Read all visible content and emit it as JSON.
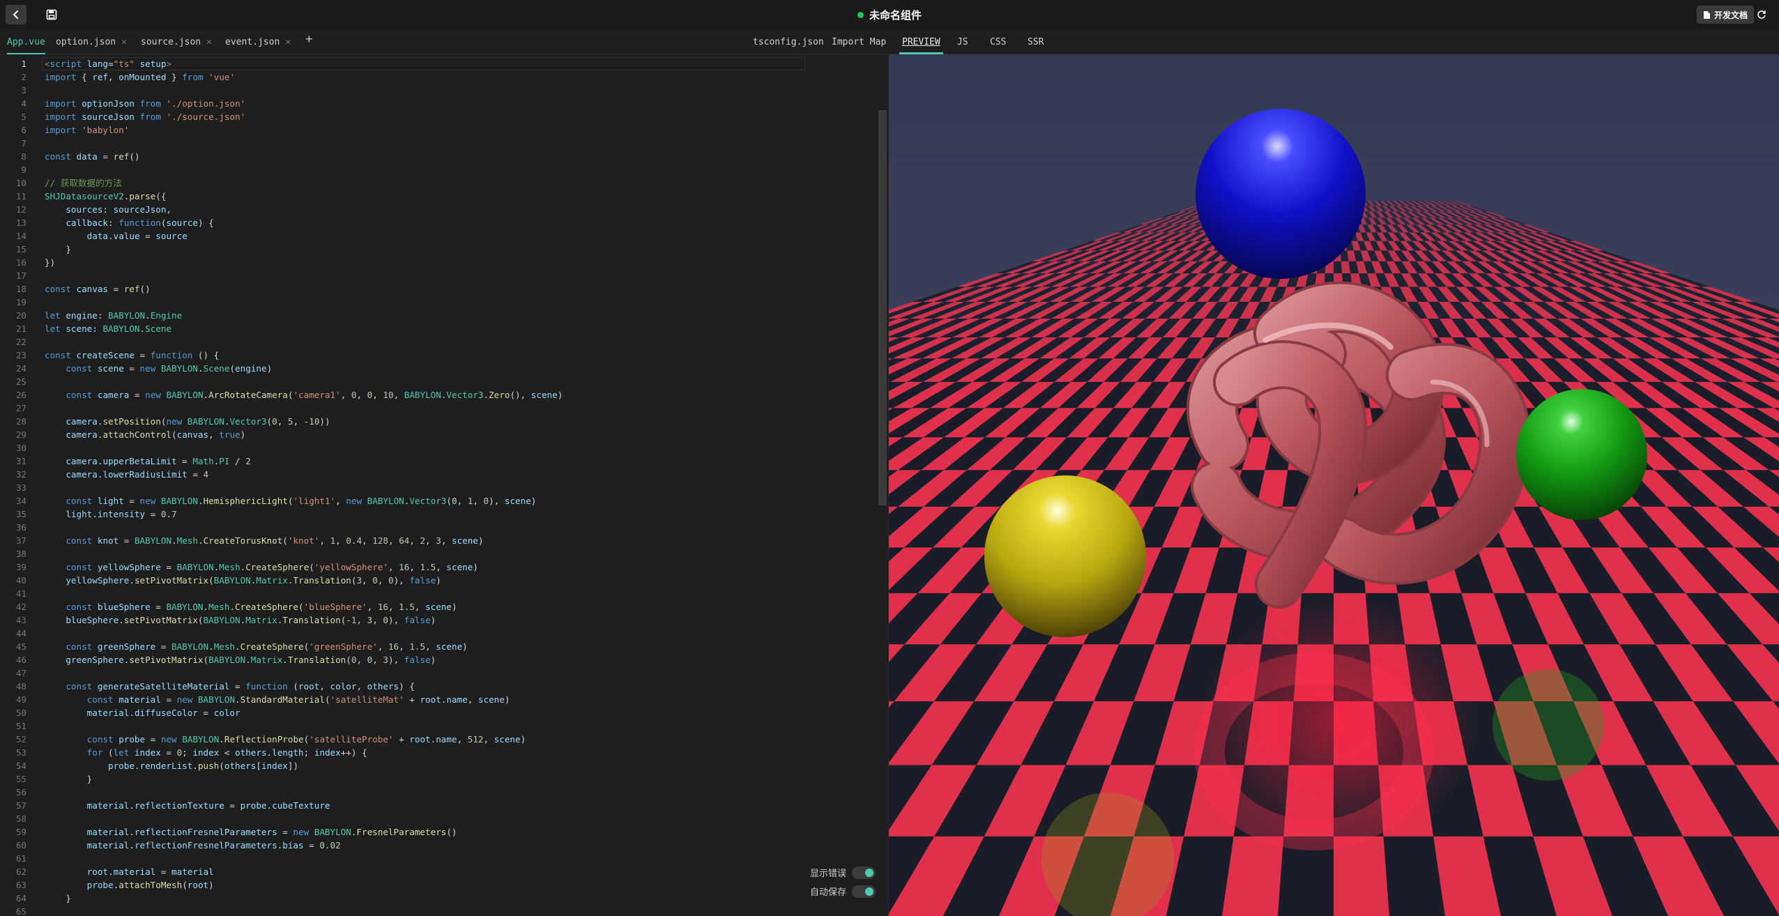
{
  "header": {
    "title": "未命名组件",
    "docs_label": "开发文档",
    "status_color": "#22c55e"
  },
  "file_tabs": [
    {
      "label": "App.vue",
      "closable": false,
      "active": true
    },
    {
      "label": "option.json",
      "closable": true,
      "active": false
    },
    {
      "label": "source.json",
      "closable": true,
      "active": false
    },
    {
      "label": "event.json",
      "closable": true,
      "active": false
    }
  ],
  "add_tab_label": "+",
  "right_tabs": [
    {
      "label": "tsconfig.json",
      "active": false
    },
    {
      "label": "Import Map",
      "active": false
    },
    {
      "label": "PREVIEW",
      "active": true
    },
    {
      "label": "JS",
      "active": false
    },
    {
      "label": "CSS",
      "active": false
    },
    {
      "label": "SSR",
      "active": false
    }
  ],
  "editor": {
    "current_line": 1,
    "lines": [
      "<script lang=\"ts\" setup>",
      "import { ref, onMounted } from 'vue'",
      "",
      "import optionJson from './option.json'",
      "import sourceJson from './source.json'",
      "import 'babylon'",
      "",
      "const data = ref()",
      "",
      "// 获取数据的方法",
      "SHJDatasourceV2.parse({",
      "    sources: sourceJson,",
      "    callback: function(source) {",
      "        data.value = source",
      "    }",
      "})",
      "",
      "const canvas = ref()",
      "",
      "let engine: BABYLON.Engine",
      "let scene: BABYLON.Scene",
      "",
      "const createScene = function () {",
      "    const scene = new BABYLON.Scene(engine)",
      "",
      "    const camera = new BABYLON.ArcRotateCamera('camera1', 0, 0, 10, BABYLON.Vector3.Zero(), scene)",
      "",
      "    camera.setPosition(new BABYLON.Vector3(0, 5, -10))",
      "    camera.attachControl(canvas, true)",
      "",
      "    camera.upperBetaLimit = Math.PI / 2",
      "    camera.lowerRadiusLimit = 4",
      "",
      "    const light = new BABYLON.HemisphericLight('light1', new BABYLON.Vector3(0, 1, 0), scene)",
      "    light.intensity = 0.7",
      "",
      "    const knot = BABYLON.Mesh.CreateTorusKnot('knot', 1, 0.4, 128, 64, 2, 3, scene)",
      "",
      "    const yellowSphere = BABYLON.Mesh.CreateSphere('yellowSphere', 16, 1.5, scene)",
      "    yellowSphere.setPivotMatrix(BABYLON.Matrix.Translation(3, 0, 0), false)",
      "",
      "    const blueSphere = BABYLON.Mesh.CreateSphere('blueSphere', 16, 1.5, scene)",
      "    blueSphere.setPivotMatrix(BABYLON.Matrix.Translation(-1, 3, 0), false)",
      "",
      "    const greenSphere = BABYLON.Mesh.CreateSphere('greenSphere', 16, 1.5, scene)",
      "    greenSphere.setPivotMatrix(BABYLON.Matrix.Translation(0, 0, 3), false)",
      "",
      "    const generateSatelliteMaterial = function (root, color, others) {",
      "        const material = new BABYLON.StandardMaterial('satelliteMat' + root.name, scene)",
      "        material.diffuseColor = color",
      "",
      "        const probe = new BABYLON.ReflectionProbe('satelliteProbe' + root.name, 512, scene)",
      "        for (let index = 0; index < others.length; index++) {",
      "            probe.renderList.push(others[index])",
      "        }",
      "",
      "        material.reflectionTexture = probe.cubeTexture",
      "",
      "        material.reflectionFresnelParameters = new BABYLON.FresnelParameters()",
      "        material.reflectionFresnelParameters.bias = 0.02",
      "",
      "        root.material = material",
      "        probe.attachToMesh(root)",
      "    }",
      ""
    ]
  },
  "toggles": [
    {
      "label": "显示错误",
      "on": true
    },
    {
      "label": "自动保存",
      "on": true
    }
  ],
  "colors": {
    "accent": "#4ec9b0",
    "checker_red": "#e0304c",
    "checker_dark": "#1a1d28",
    "sky_top": "#353a55",
    "blue_sphere": "#1010c8",
    "green_sphere": "#18b018",
    "yellow_sphere": "#d8c818",
    "knot": "#c86b72"
  }
}
